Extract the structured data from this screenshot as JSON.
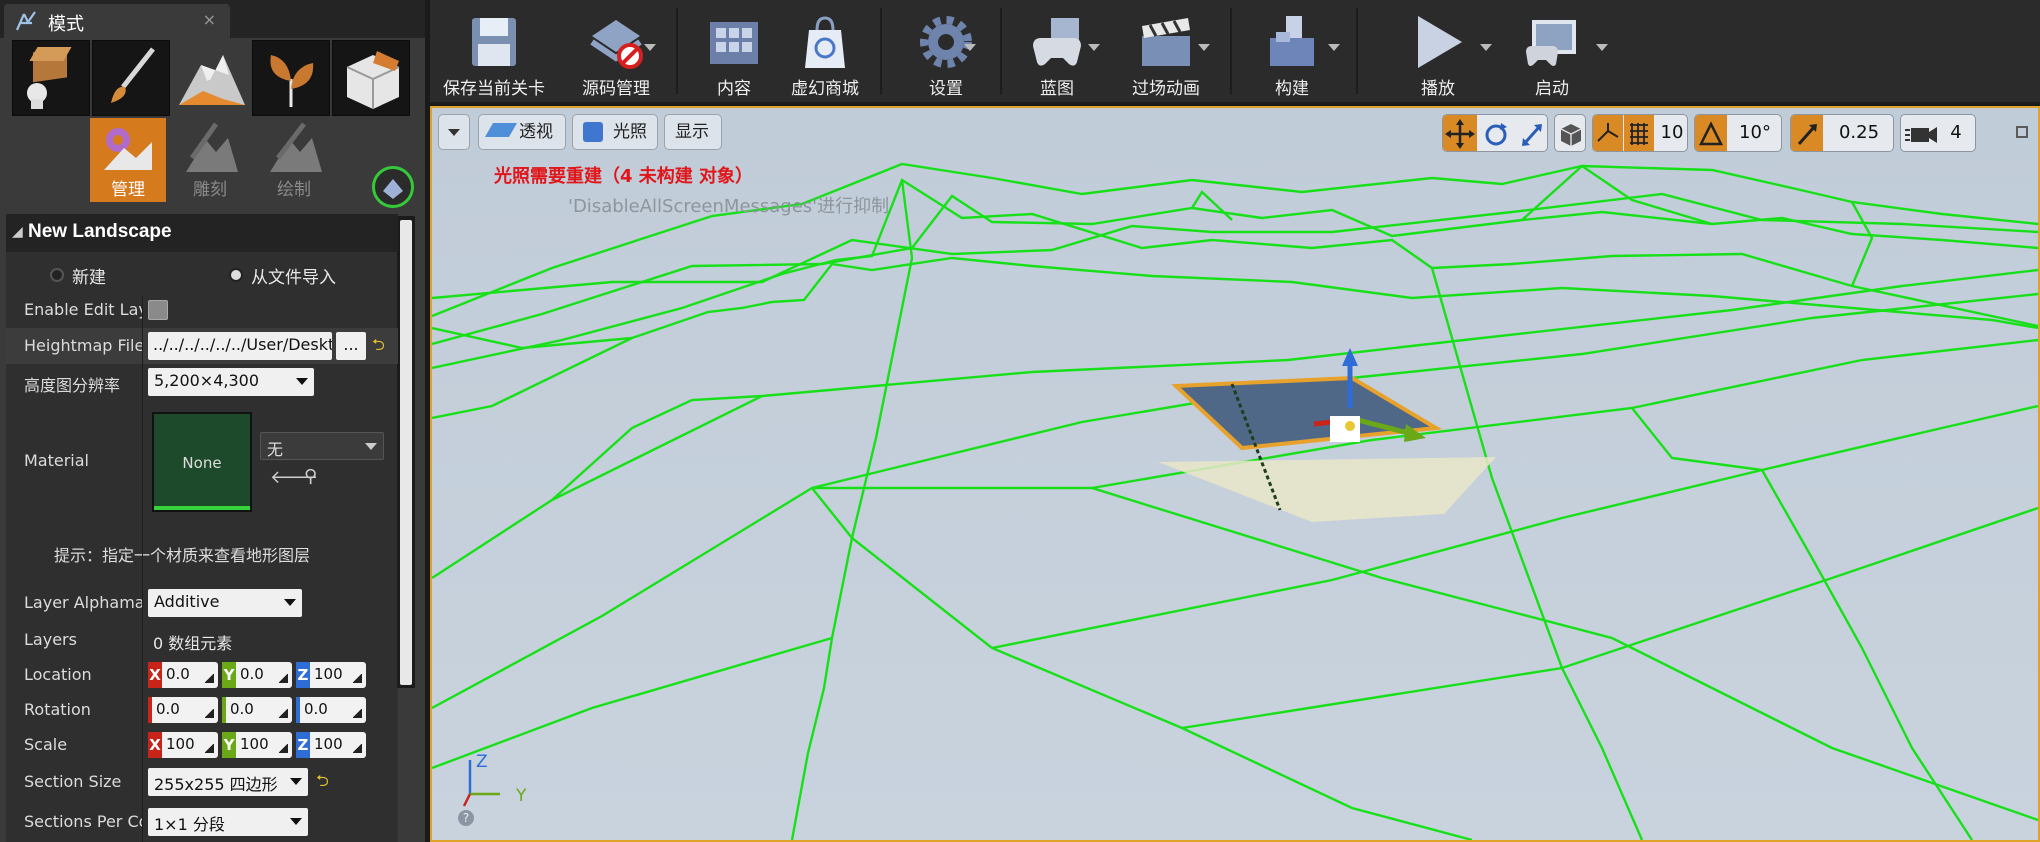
{
  "tab": {
    "title": "模式",
    "close": "×"
  },
  "submodes": [
    {
      "label": "管理",
      "active": true
    },
    {
      "label": "雕刻",
      "active": false
    },
    {
      "label": "绘制",
      "active": false
    }
  ],
  "section": {
    "title": "New Landscape"
  },
  "radios": {
    "new": "新建",
    "import": "从文件导入",
    "selected": "import"
  },
  "props": {
    "enable_edit_layers": "Enable Edit Layers",
    "heightmap_label": "Heightmap File",
    "heightmap_value": "../../../../../../User/Desktop",
    "browse": "...",
    "resolution_label": "高度图分辨率",
    "resolution_value": "5,200×4,300",
    "material_label": "Material",
    "material_thumb": "None",
    "material_combo": "无",
    "tip": "提示：指定一个材质来查看地形图层",
    "layer_alphamap_label": "Layer Alphamap Type",
    "layer_alphamap_value": "Additive",
    "layers_label": "Layers",
    "layers_value": "0 数组元素",
    "location_label": "Location",
    "location": {
      "x": "0.0",
      "y": "0.0",
      "z": "100"
    },
    "rotation_label": "Rotation",
    "rotation": {
      "x": "0.0",
      "y": "0.0",
      "z": "0.0"
    },
    "scale_label": "Scale",
    "scale": {
      "x": "100",
      "y": "100",
      "z": "100"
    },
    "section_size_label": "Section Size",
    "section_size_value": "255x255 四边形",
    "sections_per_label": "Sections Per Component",
    "sections_per_value": "1×1 分段"
  },
  "toolbar": [
    {
      "label": "保存当前关卡",
      "icon": "save-icon"
    },
    {
      "label": "源码管理",
      "icon": "source-control-icon"
    },
    {
      "label": "内容",
      "icon": "content-icon"
    },
    {
      "label": "虚幻商城",
      "icon": "marketplace-icon"
    },
    {
      "label": "设置",
      "icon": "settings-icon"
    },
    {
      "label": "蓝图",
      "icon": "blueprint-icon"
    },
    {
      "label": "过场动画",
      "icon": "cinematics-icon"
    },
    {
      "label": "构建",
      "icon": "build-icon"
    },
    {
      "label": "播放",
      "icon": "play-icon"
    },
    {
      "label": "启动",
      "icon": "launch-icon"
    }
  ],
  "viewport": {
    "perspective": "透视",
    "lit": "光照",
    "show": "显示",
    "grid_snap": "10",
    "rot_snap": "10°",
    "scale_snap": "0.25",
    "cam_speed": "4",
    "warning": "光照需要重建（4 未构建 对象）",
    "hint": "'DisableAllScreenMessages'进行抑制",
    "axis_z": "Z",
    "axis_y": "Y"
  },
  "colors": {
    "accent": "#d67a1e",
    "wire": "#17e019",
    "axis_x": "#c8241a",
    "axis_y": "#6aa817",
    "axis_z": "#2f6dd6"
  }
}
